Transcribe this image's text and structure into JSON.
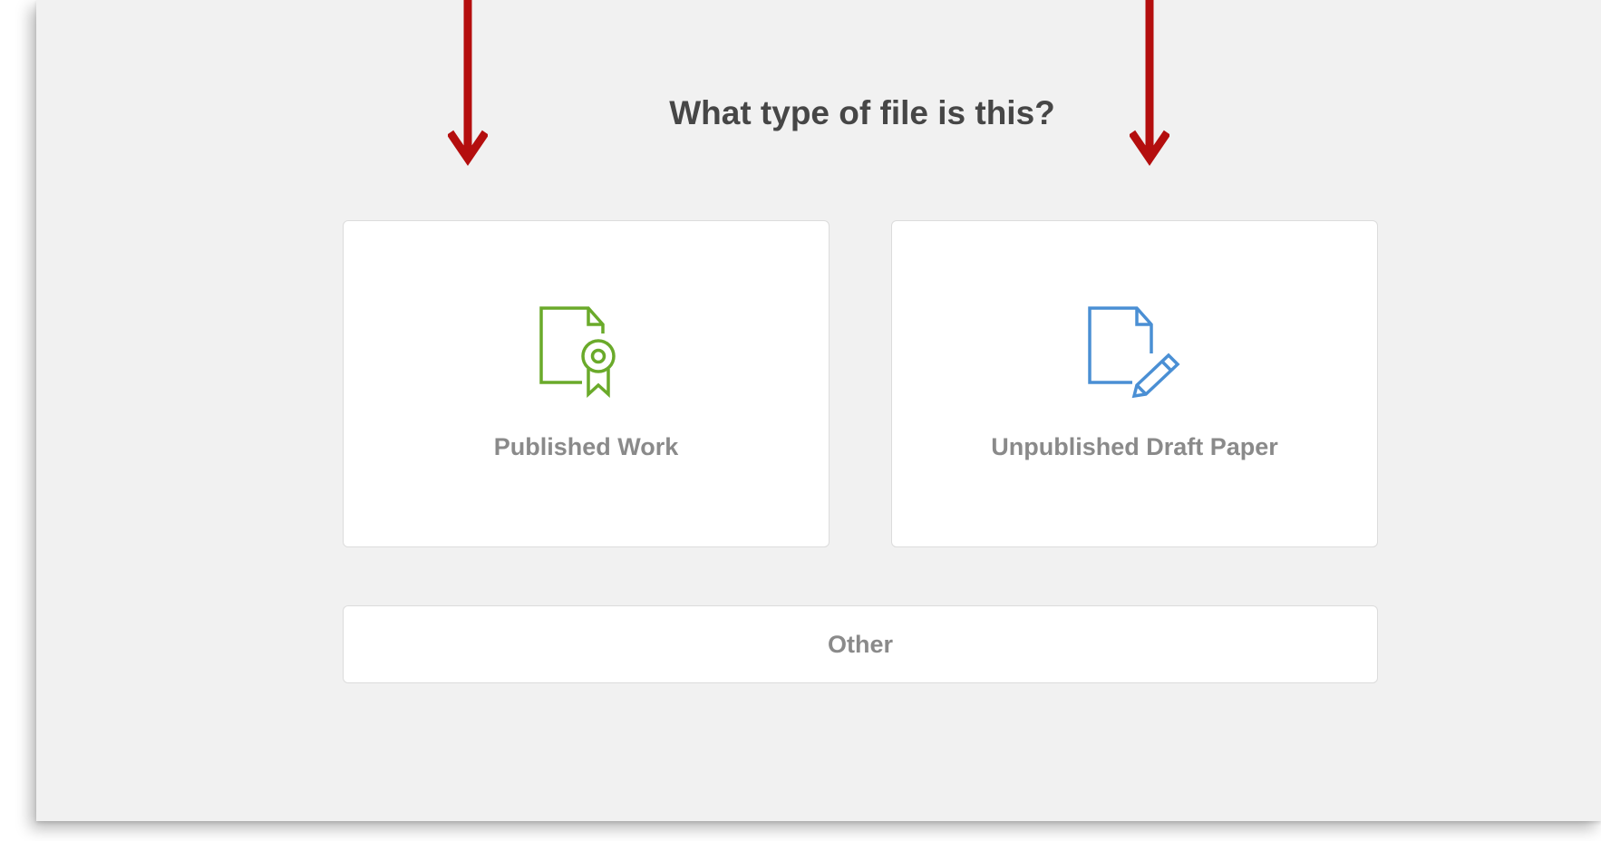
{
  "dialog": {
    "title": "What type of file is this?"
  },
  "options": {
    "published": {
      "label": "Published Work",
      "icon": "certificate-document-icon",
      "color": "#6aaa2a"
    },
    "unpublished": {
      "label": "Unpublished Draft Paper",
      "icon": "edit-document-icon",
      "color": "#4a8fd4"
    },
    "other": {
      "label": "Other"
    }
  },
  "annotations": {
    "arrow_color": "#b40e0e"
  }
}
